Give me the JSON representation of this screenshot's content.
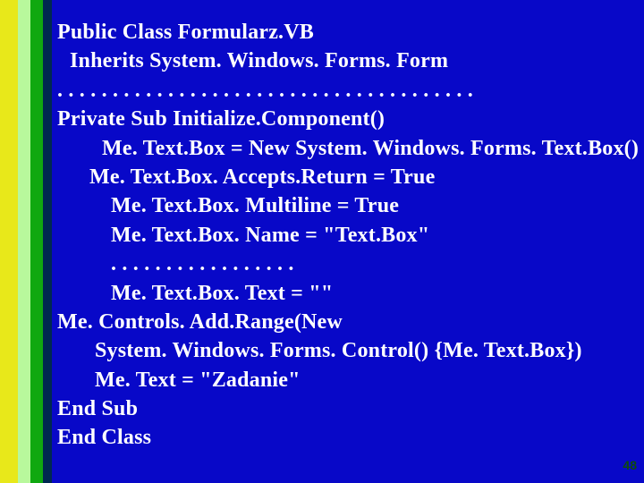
{
  "page_number": "48",
  "code": {
    "l1": "Public Class Formularz.VB",
    "l2": "Inherits System. Windows. Forms. Form",
    "l3": ". . . . . . . . . . . . . . . . . . . . . . . . . . . . . . . . . . . . . .",
    "l4": "Private Sub Initialize.Component()",
    "l5": "Me. Text.Box = New System. Windows. Forms. Text.Box()",
    "l6": "Me. Text.Box. Accepts.Return = True",
    "l7": "Me. Text.Box. Multiline = True",
    "l8": "Me. Text.Box. Name = \"Text.Box\"",
    "l9": ". . . . . . . . . . . . . . . . .",
    "l10": "Me. Text.Box. Text = \"\"",
    "l11": "Me. Controls. Add.Range(New",
    "l12": "System. Windows. Forms. Control() {Me. Text.Box})",
    "l13": "Me. Text = \"Zadanie\"",
    "l14": "End Sub",
    "l15": "End Class"
  }
}
